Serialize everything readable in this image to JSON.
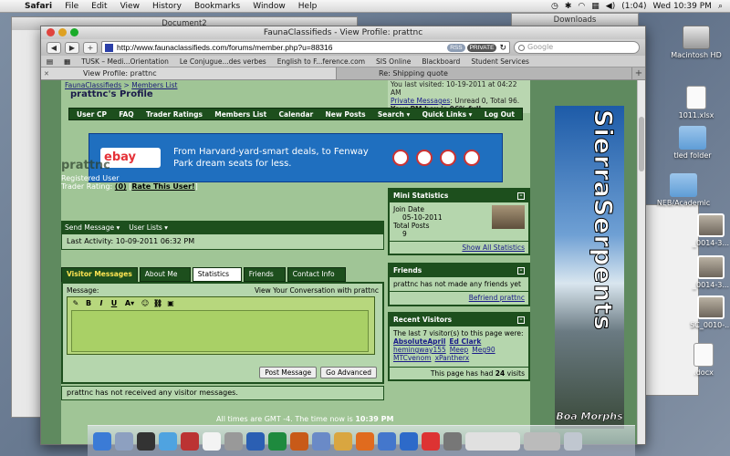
{
  "menubar": {
    "app": "Safari",
    "items": [
      "File",
      "Edit",
      "View",
      "History",
      "Bookmarks",
      "Window",
      "Help"
    ],
    "battery": "(1:04)",
    "clock": "Wed 10:39 PM"
  },
  "desktop": {
    "icons": [
      {
        "label": "Macintosh HD",
        "kind": "hd"
      },
      {
        "label": "1011.xlsx",
        "kind": "doc"
      },
      {
        "label": "tled folder",
        "kind": "folder"
      },
      {
        "label": "NEB/Academic",
        "kind": "folder"
      },
      {
        "label": "_0014-3...",
        "kind": "photo"
      },
      {
        "label": "_0014-3...",
        "kind": "photo"
      },
      {
        "label": "SC_0010-...",
        "kind": "photo"
      },
      {
        "label": ".docx",
        "kind": "doc"
      }
    ],
    "bg_windows": {
      "document2": "Document2",
      "downloads": "Downloads"
    }
  },
  "browser": {
    "window_title": "FaunaClassifieds - View Profile: prattnc",
    "url": "http://www.faunaclassifieds.com/forums/member.php?u=88316",
    "rss_label": "RSS",
    "private_label": "PRIVATE",
    "search_placeholder": "Google",
    "bookmarks": [
      "TUSK – Medi...Orientation",
      "Le Conjugue...des verbes",
      "English to F...ference.com",
      "SIS Online",
      "Blackboard",
      "Student Services"
    ],
    "tabs": [
      {
        "label": "View Profile: prattnc",
        "active": true
      },
      {
        "label": "Re: Shipping quote",
        "active": false
      }
    ]
  },
  "page": {
    "breadcrumb": "FaunaClassifieds",
    "breadcrumb_sub": "Members List",
    "profile_title": "prattnc's Profile",
    "last_visited": "You last visited: 10-19-2011 at 04:22 AM",
    "private_messages_link": "Private Messages",
    "private_messages_status": ": Unread 0, Total 96.",
    "pm_box": "Your PM box is 96% full.",
    "nav": [
      "User CP",
      "FAQ",
      "Trader Ratings",
      "Members List",
      "Calendar",
      "New Posts",
      "Search ▾",
      "Quick Links ▾",
      "Log Out"
    ],
    "ad": {
      "logo": "ebay",
      "text": "From Harvard-yard-smart deals, to Fenway Park dream seats for less."
    },
    "username": "prattnc",
    "role": "Registered User",
    "trader_rating_label": "Trader Rating:",
    "trader_rating_value": "(0)",
    "rate_link": "Rate This User!",
    "send_message": "Send Message ▾",
    "user_lists": "User Lists ▾",
    "last_activity": "Last Activity: 10-09-2011 06:32 PM",
    "profile_tabs": [
      "Visitor Messages",
      "About Me",
      "Statistics",
      "Friends",
      "Contact Info"
    ],
    "message_label": "Message:",
    "view_conversation": "View Your Conversation with prattnc",
    "post_button": "Post Message",
    "advanced_button": "Go Advanced",
    "no_messages": "prattnc has not received any visitor messages.",
    "mini_stats": {
      "title": "Mini Statistics",
      "join_label": "Join Date",
      "join_value": "05-10-2011",
      "posts_label": "Total Posts",
      "posts_value": "9",
      "footer": "Show All Statistics"
    },
    "friends": {
      "title": "Friends",
      "body": "prattnc has not made any friends yet",
      "footer": "Befriend prattnc"
    },
    "recent_visitors": {
      "title": "Recent Visitors",
      "intro": "The last 7 visitor(s) to this page were:",
      "names": [
        "AbsoluteApril",
        "Ed Clark",
        "hemingway155",
        "Meep",
        "Meg90",
        "MTCvenom",
        "xPantherx"
      ],
      "footer_prefix": "This page has had",
      "footer_count": "24",
      "footer_suffix": "visits"
    },
    "timezone_text": "All times are GMT -4. The time now is",
    "timezone_time": "10:39 PM",
    "side_banner_word": "SierraSerpents",
    "side_banner_sub": "Boa Morphs"
  }
}
